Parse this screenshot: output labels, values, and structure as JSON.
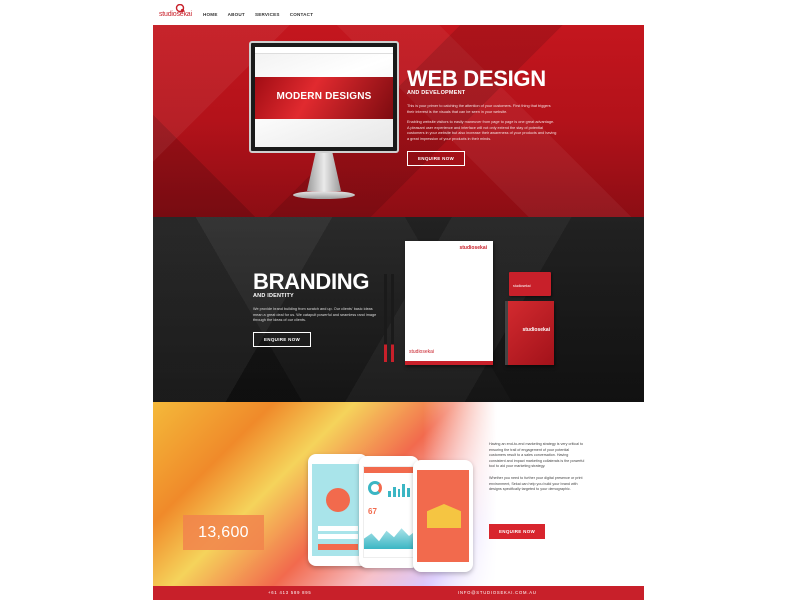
{
  "header": {
    "logo": {
      "text": "studiosekai"
    },
    "nav": [
      {
        "label": "HOME"
      },
      {
        "label": "ABOUT"
      },
      {
        "label": "SERVICES"
      },
      {
        "label": "CONTACT"
      }
    ]
  },
  "web_design": {
    "title": "WEB DESIGN",
    "subtitle": "AND DEVELOPMENT",
    "screen_title": "MODERN DESIGNS",
    "paragraphs": [
      "This is your primer to catching the attention of your customers. First thing that triggers their interest is the visuals that can be seen in your website.",
      "Enabling website visitors to easily maneuver from page to page is one great advantage. A pleasant user experience and interface will not only extend the stay of potential customers in your website but also increase their awareness of your products and having a great impression of your products in their minds."
    ],
    "button": "ENQUIRE NOW"
  },
  "branding": {
    "title": "BRANDING",
    "subtitle": "AND IDENTITY",
    "paragraph": "We provide brand building from scratch and up. Our clients' basic ideas mean a great deal for us. We catapult powerful and seamless rand image through the ideas of our clients.",
    "button": "ENQUIRE NOW",
    "letterhead_logo": "studiosekai",
    "letterhead_footer": "studiosekai",
    "card_text": "studiosekai",
    "notebook_text": "studiosekai"
  },
  "marketing": {
    "stat": "13,600",
    "phone2_number": "67",
    "paragraphs": [
      "Having an end-to-end marketing strategy is very critical to ensuring the trail of engagement of your potential customers result to a sales conversation. Having consistent and impact marketing collaterals is the powerful tool to aid your marketing strategy.",
      "Whether you need to further your digital presence or print environment, Sekai can help you build your brand with designs specifically targeted to your demographic."
    ],
    "button": "ENQUIRE NOW"
  },
  "footer": {
    "phone": "+61 413 589 895",
    "email": "INFO@STUDIOSEKAI.COM.AU"
  },
  "colors": {
    "brand_red": "#c8202a",
    "dark": "#1e1e1e",
    "accent_orange": "#f26a4d"
  }
}
